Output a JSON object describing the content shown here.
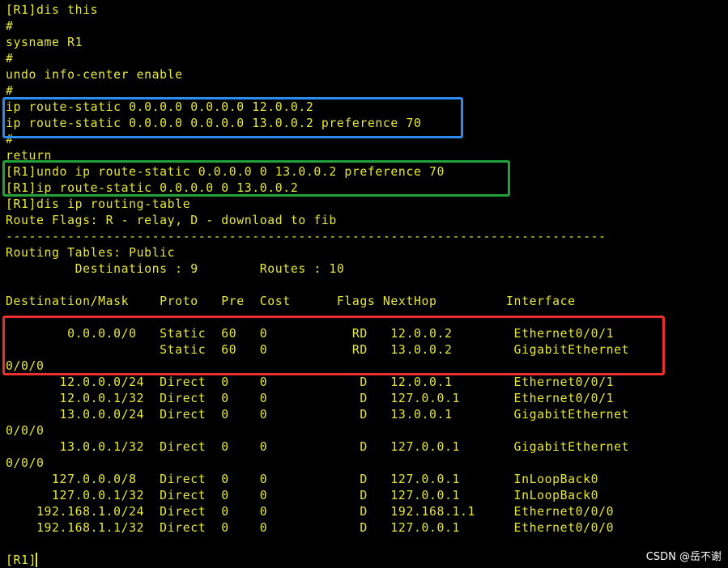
{
  "terminal": {
    "lines": [
      "[R1]dis this",
      "#",
      "sysname R1",
      "#",
      "undo info-center enable",
      "#",
      "ip route-static 0.0.0.0 0.0.0.0 12.0.0.2",
      "ip route-static 0.0.0.0 0.0.0.0 13.0.0.2 preference 70",
      "#",
      "return",
      "[R1]undo ip route-static 0.0.0.0 0 13.0.0.2 preference 70",
      "[R1]ip route-static 0.0.0.0 0 13.0.0.2",
      "[R1]dis ip routing-table",
      "Route Flags: R - relay, D - download to fib",
      "------------------------------------------------------------------------------",
      "Routing Tables: Public",
      "         Destinations : 9        Routes : 10",
      "",
      "Destination/Mask    Proto   Pre  Cost      Flags NextHop         Interface",
      "",
      "        0.0.0.0/0   Static  60   0           RD   12.0.0.2        Ethernet0/0/1",
      "                    Static  60   0           RD   13.0.0.2        GigabitEthernet",
      "0/0/0",
      "       12.0.0.0/24  Direct  0    0            D   12.0.0.1        Ethernet0/0/1",
      "       12.0.0.1/32  Direct  0    0            D   127.0.0.1       Ethernet0/0/1",
      "       13.0.0.0/24  Direct  0    0            D   13.0.0.1        GigabitEthernet",
      "0/0/0",
      "       13.0.0.1/32  Direct  0    0            D   127.0.0.1       GigabitEthernet",
      "0/0/0",
      "      127.0.0.0/8   Direct  0    0            D   127.0.0.1       InLoopBack0",
      "      127.0.0.1/32  Direct  0    0            D   127.0.0.1       InLoopBack0",
      "    192.168.1.0/24  Direct  0    0            D   192.168.1.1     Ethernet0/0/0",
      "    192.168.1.1/32  Direct  0    0            D   127.0.0.1       Ethernet0/0/0",
      "",
      "[R1]"
    ]
  },
  "watermark": "CSDN @岳不谢",
  "colors": {
    "background": "#000000",
    "text": "#e8e83a",
    "box_blue": "#2b8cf0",
    "box_green": "#21a33a",
    "box_red": "#ea2f2f"
  }
}
